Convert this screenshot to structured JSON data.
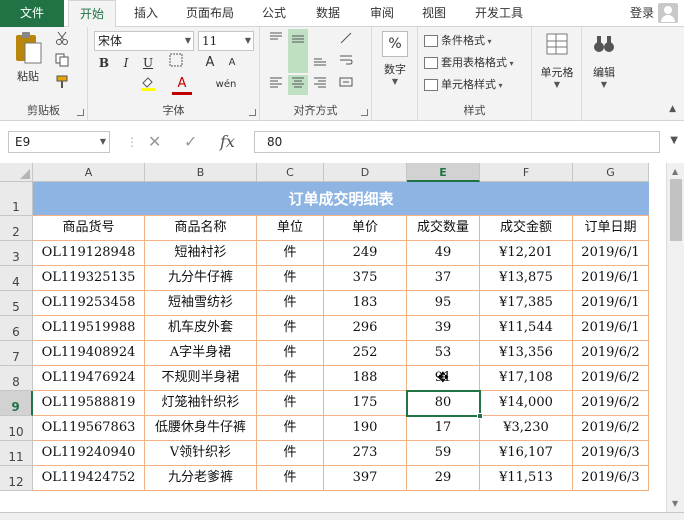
{
  "tabs": [
    "文件",
    "开始",
    "插入",
    "页面布局",
    "公式",
    "数据",
    "审阅",
    "视图",
    "开发工具"
  ],
  "account": {
    "login_label": "登录"
  },
  "ribbon": {
    "clipboard": {
      "paste_label": "粘贴",
      "group_label": "剪贴板"
    },
    "font": {
      "font_name": "宋体",
      "font_size": "11",
      "bold": "B",
      "italic": "I",
      "underline": "U",
      "grow": "A",
      "shrink": "A",
      "font_color": "A",
      "phonetic": "wén",
      "group_label": "字体"
    },
    "alignment": {
      "group_label": "对齐方式"
    },
    "number": {
      "label": "数字",
      "percent": "%"
    },
    "styles": {
      "conditional": "条件格式",
      "table_format": "套用表格格式",
      "cell_styles": "单元格样式",
      "group_label": "样式"
    },
    "cells": {
      "label": "单元格"
    },
    "editing": {
      "label": "编辑"
    }
  },
  "formula_bar": {
    "cell_ref": "E9",
    "fx": "fx",
    "value": "80"
  },
  "columns": [
    "A",
    "B",
    "C",
    "D",
    "E",
    "F",
    "G"
  ],
  "rows": [
    "1",
    "2",
    "3",
    "4",
    "5",
    "6",
    "7",
    "8",
    "9",
    "10",
    "11",
    "12"
  ],
  "sheet": {
    "title": "订单成交明细表",
    "headers": [
      "商品货号",
      "商品名称",
      "单位",
      "单价",
      "成交数量",
      "成交金额",
      "订单日期"
    ],
    "data": [
      [
        "OL119128948",
        "短袖衬衫",
        "件",
        "249",
        "49",
        "¥12,201",
        "2019/6/1"
      ],
      [
        "OL119325135",
        "九分牛仔裤",
        "件",
        "375",
        "37",
        "¥13,875",
        "2019/6/1"
      ],
      [
        "OL119253458",
        "短袖雪纺衫",
        "件",
        "183",
        "95",
        "¥17,385",
        "2019/6/1"
      ],
      [
        "OL119519988",
        "机车皮外套",
        "件",
        "296",
        "39",
        "¥11,544",
        "2019/6/1"
      ],
      [
        "OL119408924",
        "A字半身裙",
        "件",
        "252",
        "53",
        "¥13,356",
        "2019/6/2"
      ],
      [
        "OL119476924",
        "不规则半身裙",
        "件",
        "188",
        "91",
        "¥17,108",
        "2019/6/2"
      ],
      [
        "OL119588819",
        "灯笼袖针织衫",
        "件",
        "175",
        "80",
        "¥14,000",
        "2019/6/2"
      ],
      [
        "OL119567863",
        "低腰休身牛仔裤",
        "件",
        "190",
        "17",
        "¥3,230",
        "2019/6/2"
      ],
      [
        "OL119240940",
        "V领针织衫",
        "件",
        "273",
        "59",
        "¥16,107",
        "2019/6/3"
      ],
      [
        "OL119424752",
        "九分老爹裤",
        "件",
        "397",
        "29",
        "¥11,513",
        "2019/6/3"
      ]
    ]
  },
  "colors": {
    "accent": "#217346",
    "title_fill": "#8db4e2",
    "grid_border": "#f4b183"
  }
}
